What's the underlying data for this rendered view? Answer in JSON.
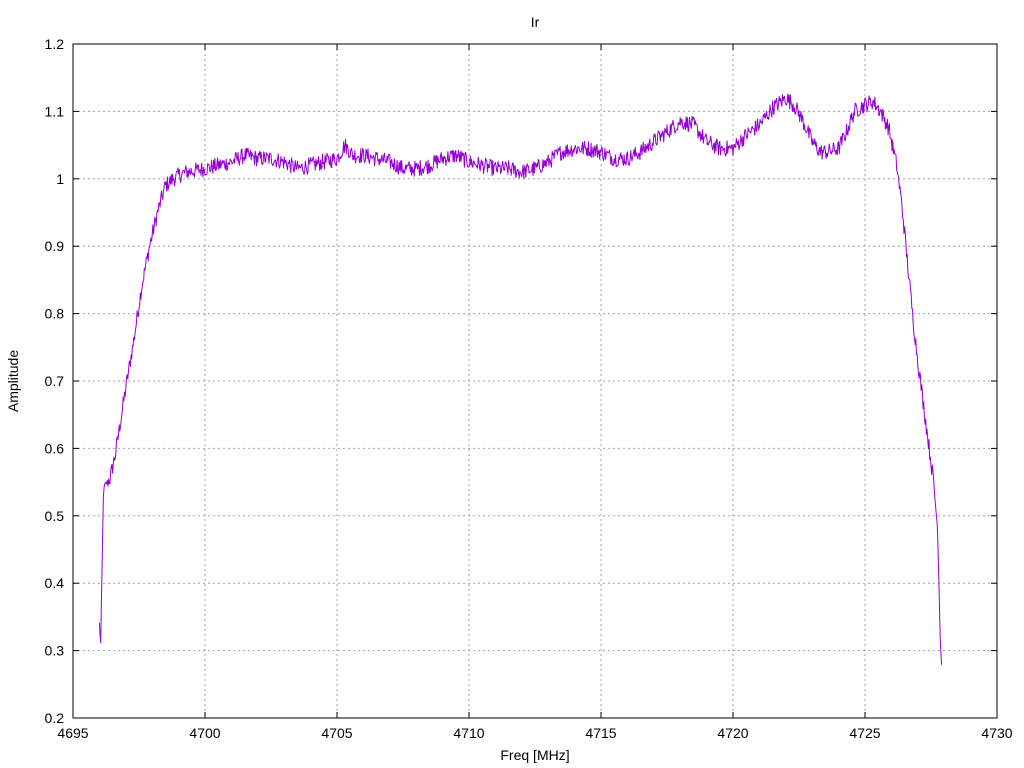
{
  "chart_data": {
    "type": "line",
    "title": "Ir",
    "xlabel": "Freq [MHz]",
    "ylabel": "Amplitude",
    "xlim": [
      4695,
      4730
    ],
    "ylim": [
      0.2,
      1.2
    ],
    "x_ticks": [
      4695,
      4700,
      4705,
      4710,
      4715,
      4720,
      4725,
      4730
    ],
    "x_tick_labels": [
      "4695",
      "4700",
      "4705",
      "4710",
      "4715",
      "4720",
      "4725",
      "4730"
    ],
    "y_ticks": [
      0.2,
      0.3,
      0.4,
      0.5,
      0.6,
      0.7,
      0.8,
      0.9,
      1.0,
      1.1,
      1.2
    ],
    "y_tick_labels": [
      "0.2",
      "0.3",
      "0.4",
      "0.5",
      "0.6",
      "0.7",
      "0.8",
      "0.9",
      "1",
      "1.1",
      "1.2"
    ],
    "grid": true,
    "series": [
      {
        "color": "#9400d3",
        "noise": 0.012,
        "x": [
          4696.0,
          4696.05,
          4696.15,
          4696.2,
          4696.4,
          4696.6,
          4696.8,
          4697.0,
          4697.3,
          4697.6,
          4697.9,
          4698.2,
          4698.5,
          4698.8,
          4699.0,
          4699.3,
          4699.6,
          4700.0,
          4700.5,
          4701.0,
          4701.5,
          4702.0,
          4702.5,
          4703.0,
          4703.5,
          4704.0,
          4704.5,
          4705.0,
          4705.3,
          4705.6,
          4706.0,
          4706.5,
          4707.0,
          4707.5,
          4708.0,
          4708.5,
          4709.0,
          4709.5,
          4710.0,
          4710.5,
          4711.0,
          4711.5,
          4712.0,
          4712.5,
          4713.0,
          4713.5,
          4714.0,
          4714.5,
          4715.0,
          4715.5,
          4716.0,
          4716.5,
          4717.0,
          4717.5,
          4718.0,
          4718.5,
          4719.0,
          4719.5,
          4720.0,
          4720.5,
          4721.0,
          4721.5,
          4722.0,
          4722.3,
          4722.6,
          4723.0,
          4723.3,
          4723.6,
          4724.0,
          4724.3,
          4724.6,
          4725.0,
          4725.3,
          4725.6,
          4725.9,
          4726.2,
          4726.4,
          4726.6,
          4726.8,
          4727.0,
          4727.2,
          4727.4,
          4727.6,
          4727.75,
          4727.8,
          4727.85,
          4727.9
        ],
        "y": [
          0.34,
          0.31,
          0.53,
          0.545,
          0.555,
          0.59,
          0.64,
          0.69,
          0.76,
          0.84,
          0.9,
          0.95,
          0.99,
          1.0,
          1.005,
          1.01,
          1.012,
          1.015,
          1.02,
          1.025,
          1.035,
          1.03,
          1.03,
          1.025,
          1.015,
          1.02,
          1.025,
          1.03,
          1.05,
          1.035,
          1.035,
          1.03,
          1.025,
          1.015,
          1.015,
          1.02,
          1.03,
          1.035,
          1.025,
          1.02,
          1.015,
          1.015,
          1.01,
          1.015,
          1.025,
          1.04,
          1.045,
          1.045,
          1.04,
          1.03,
          1.03,
          1.04,
          1.055,
          1.07,
          1.085,
          1.08,
          1.055,
          1.045,
          1.045,
          1.065,
          1.08,
          1.105,
          1.12,
          1.11,
          1.09,
          1.055,
          1.04,
          1.04,
          1.045,
          1.07,
          1.1,
          1.11,
          1.115,
          1.1,
          1.075,
          1.02,
          0.96,
          0.88,
          0.8,
          0.73,
          0.67,
          0.61,
          0.55,
          0.48,
          0.4,
          0.32,
          0.28
        ]
      }
    ]
  }
}
